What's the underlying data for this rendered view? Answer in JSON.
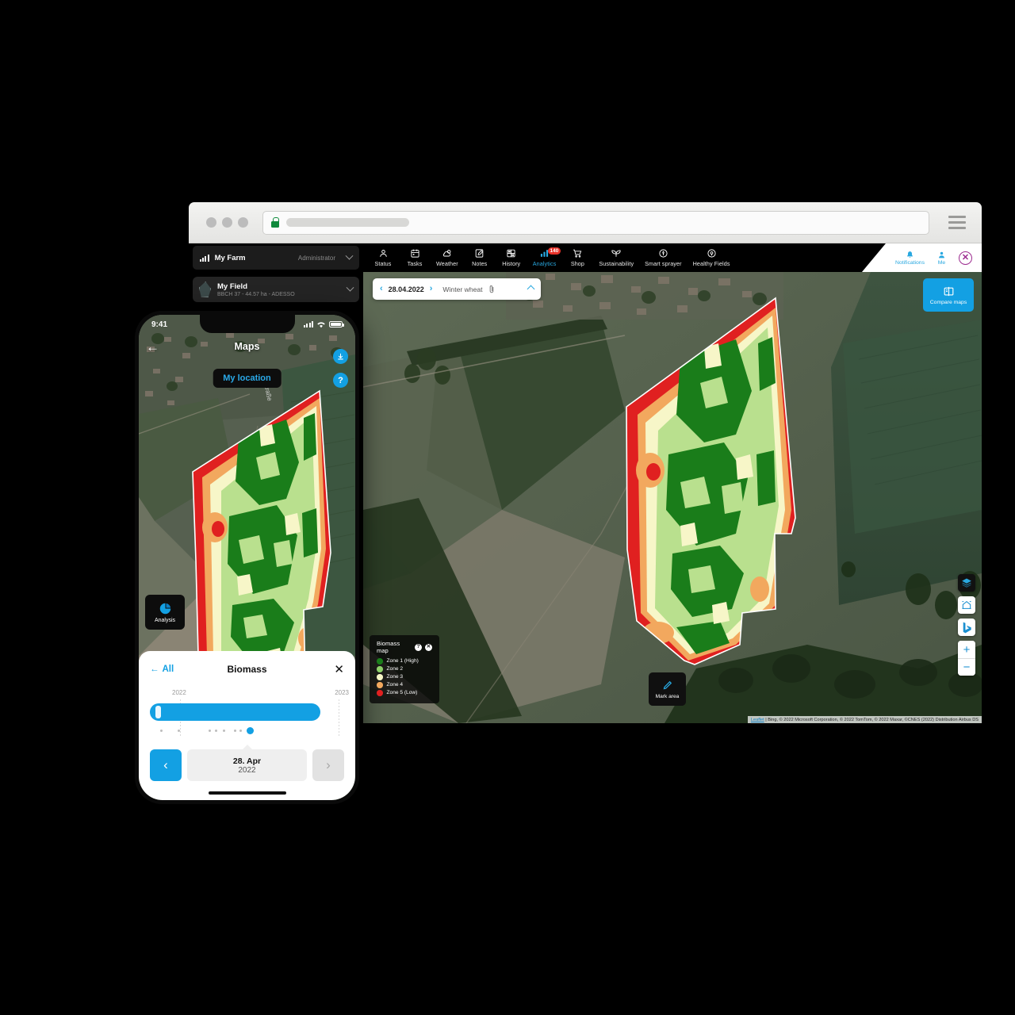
{
  "browser": {
    "url_placeholder": "",
    "lock_icon": "lock-icon",
    "menu_icon": "hamburger-icon"
  },
  "header": {
    "farm": {
      "name": "My Farm",
      "role": "Administrator",
      "icon": "signal-bars-icon"
    },
    "nav": [
      {
        "label": "Status",
        "icon": "status-icon",
        "active": false,
        "badge": ""
      },
      {
        "label": "Tasks",
        "icon": "calendar-icon",
        "active": false,
        "badge": ""
      },
      {
        "label": "Weather",
        "icon": "weather-icon",
        "active": false,
        "badge": ""
      },
      {
        "label": "Notes",
        "icon": "notes-icon",
        "active": false,
        "badge": ""
      },
      {
        "label": "History",
        "icon": "history-icon",
        "active": false,
        "badge": ""
      },
      {
        "label": "Analytics",
        "icon": "analytics-icon",
        "active": true,
        "badge": "140"
      },
      {
        "label": "Shop",
        "icon": "cart-icon",
        "active": false,
        "badge": ""
      },
      {
        "label": "Sustainability",
        "icon": "sustainability-icon",
        "active": false,
        "badge": ""
      },
      {
        "label": "Smart sprayer",
        "icon": "sprayer-icon",
        "active": false,
        "badge": ""
      },
      {
        "label": "Healthy Fields",
        "icon": "healthy-fields-icon",
        "active": false,
        "badge": ""
      }
    ],
    "right": {
      "notifications_label": "Notifications",
      "me_label": "Me",
      "logo_glyph": "✕"
    }
  },
  "sidebar": {
    "field": {
      "title": "My Field",
      "subtitle": "BBCH 37 - 44.57 ha - ADESSO",
      "icon": "field-shape-icon"
    }
  },
  "map": {
    "datebar": {
      "prev": "‹",
      "date": "28.04.2022",
      "next": "›",
      "crop": "Winter wheat",
      "attachment_icon": "paperclip-icon",
      "collapse_icon": "chevron-up-icon"
    },
    "compare": {
      "label": "Compare maps",
      "icon": "compare-maps-icon"
    },
    "mark_area": {
      "label": "Mark area",
      "icon": "pencil-icon"
    },
    "legend": {
      "title": "Biomass map",
      "help_glyph": "?",
      "close_glyph": "✕",
      "zones": [
        {
          "label": "Zone 1 (High)",
          "color": "#1a7d1a"
        },
        {
          "label": "Zone 2",
          "color": "#8ed16a"
        },
        {
          "label": "Zone 3",
          "color": "#f7f6c8"
        },
        {
          "label": "Zone 4",
          "color": "#f2a85e"
        },
        {
          "label": "Zone 5 (Low)",
          "color": "#e02020"
        }
      ]
    },
    "controls": [
      {
        "name": "layers-icon",
        "glyph": ""
      },
      {
        "name": "home-icon",
        "glyph": ""
      },
      {
        "name": "bing-logo-icon",
        "glyph": "b"
      }
    ],
    "zoom_in": "+",
    "zoom_out": "−",
    "attribution_link": "Leaflet",
    "attribution": " | Bing, © 2022 Microsoft Corporation, © 2022 TomTom, © 2022 Maxar, ©CNES (2022) Distribution Airbus DS"
  },
  "phone": {
    "status": {
      "time": "9:41",
      "signal_icon": "signal-icon",
      "wifi_icon": "wifi-icon",
      "battery_icon": "battery-icon"
    },
    "back_glyph": "←",
    "title": "Maps",
    "my_location": "My location",
    "download_glyph": "⤓",
    "help_glyph": "?",
    "analysis": {
      "label": "Analysis",
      "icon": "pie-chart-icon"
    },
    "sheet": {
      "all_label": "All",
      "back_glyph": "←",
      "title": "Biomass",
      "close_glyph": "✕",
      "year_left": "2022",
      "year_right": "2023",
      "prev_glyph": "‹",
      "next_glyph": "›",
      "date_day": "28. Apr",
      "date_year": "2022"
    }
  },
  "colors": {
    "accent": "#13a0e3",
    "badge_red": "#e8332a",
    "logo_purple": "#9c2a8f"
  }
}
